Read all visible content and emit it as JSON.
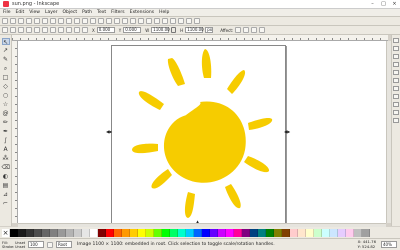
{
  "window": {
    "title": "sun.png - Inkscape",
    "minimize": "–",
    "maximize": "□",
    "close": "×"
  },
  "menu": [
    "File",
    "Edit",
    "View",
    "Layer",
    "Object",
    "Path",
    "Text",
    "Filters",
    "Extensions",
    "Help"
  ],
  "controls": {
    "x_label": "X",
    "x_value": "0.000",
    "y_label": "Y",
    "y_value": "0.000",
    "w_label": "W",
    "w_value": "1100.00",
    "h_label": "H",
    "h_value": "1100.00",
    "unit": "px",
    "affect_label": "Affect:"
  },
  "tools": [
    {
      "name": "selector-tool",
      "glyph": "↖"
    },
    {
      "name": "node-tool",
      "glyph": "↗"
    },
    {
      "name": "tweak-tool",
      "glyph": "✎"
    },
    {
      "name": "zoom-tool",
      "glyph": "⌕"
    },
    {
      "name": "rect-tool",
      "glyph": "□"
    },
    {
      "name": "3dbox-tool",
      "glyph": "◇"
    },
    {
      "name": "ellipse-tool",
      "glyph": "○"
    },
    {
      "name": "star-tool",
      "glyph": "☆"
    },
    {
      "name": "spiral-tool",
      "glyph": "@"
    },
    {
      "name": "pencil-tool",
      "glyph": "✏"
    },
    {
      "name": "pen-tool",
      "glyph": "✒"
    },
    {
      "name": "calligraphy-tool",
      "glyph": "∫"
    },
    {
      "name": "text-tool",
      "glyph": "A"
    },
    {
      "name": "spray-tool",
      "glyph": "⁂"
    },
    {
      "name": "eraser-tool",
      "glyph": "⌫"
    },
    {
      "name": "bucket-tool",
      "glyph": "◐"
    },
    {
      "name": "gradient-tool",
      "glyph": "▤"
    },
    {
      "name": "dropper-tool",
      "glyph": "⊿"
    },
    {
      "name": "connector-tool",
      "glyph": "⌐"
    }
  ],
  "palette": [
    "#000000",
    "#1a1a1a",
    "#333333",
    "#4d4d4d",
    "#666666",
    "#808080",
    "#999999",
    "#b3b3b3",
    "#cccccc",
    "#e6e6e6",
    "#ffffff",
    "#800000",
    "#ff0000",
    "#ff6600",
    "#ff9900",
    "#ffcc00",
    "#ffff00",
    "#ccff00",
    "#66ff00",
    "#00ff00",
    "#00ff66",
    "#00ffcc",
    "#00ccff",
    "#0066ff",
    "#0000ff",
    "#6600ff",
    "#cc00ff",
    "#ff00ff",
    "#ff0099",
    "#800080",
    "#004080",
    "#008080",
    "#008000",
    "#808000",
    "#804000",
    "#ffcccc",
    "#ffe6cc",
    "#ffffcc",
    "#ccffcc",
    "#ccffff",
    "#cce6ff",
    "#e6ccff",
    "#ffccee",
    "#c0c0c0",
    "#a0a0a0"
  ],
  "status": {
    "fill_label": "Fill:",
    "fill_value": "Unset",
    "stroke_label": "Stroke:",
    "stroke_value": "Unset",
    "opacity_value": "100",
    "layer_value": "Root",
    "message": "Image 1100 × 1100: embedded in root. Click selection to toggle scale/rotation handles.",
    "x_coord": "X: 441.76",
    "y_coord": "Y: 524.82",
    "zoom": "40%"
  },
  "colors": {
    "sun": "#f6cc00"
  }
}
